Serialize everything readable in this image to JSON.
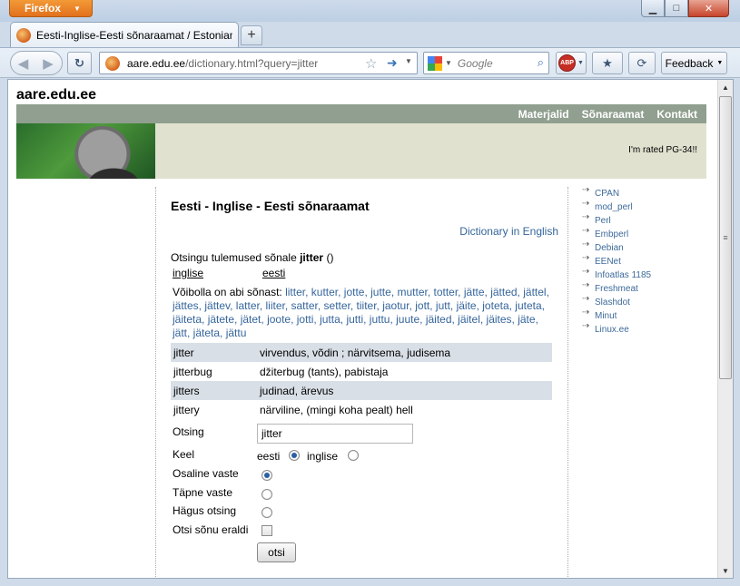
{
  "browser": {
    "menu_button": "Firefox",
    "tab_title": "Eesti-Inglise-Eesti sõnaraamat / Estonian...",
    "url_host": "aare.edu.ee",
    "url_path": "/dictionary.html?query=jitter",
    "search_placeholder": "Google",
    "abp_label": "ABP",
    "feedback_label": "Feedback"
  },
  "site": {
    "title": "aare.edu.ee",
    "nav": [
      "Materjalid",
      "Sõnaraamat",
      "Kontakt"
    ],
    "banner_text": "I'm rated PG-34!!"
  },
  "sidebar_links": [
    "CPAN",
    "mod_perl",
    "Perl",
    "Embperl",
    "Debian",
    "EENet",
    "Infoatlas 1185",
    "Freshmeat",
    "Slashdot",
    "Minut",
    "Linux.ee"
  ],
  "main": {
    "heading": "Eesti - Inglise - Eesti sõnaraamat",
    "english_link": "Dictionary in English",
    "results_prefix": "Otsingu tulemused sõnale",
    "query_word": "jitter",
    "results_suffix": "()",
    "col_left": "inglise",
    "col_right": "eesti",
    "suggest_prefix": "Võibolla on abi sõnast:",
    "suggest_words": "litter, kutter, jotte, jutte, mutter, totter, jätte, jätted, jättel, jättes, jättev, latter, liiter, satter, setter, tiiter, jaotur, jott, jutt, jäite, joteta, juteta, jäiteta, jätete, jätet, joote, jotti, jutta, jutti, juttu, juute, jäited, jäitel, jäites, jäte, jätt, jäteta, jättu",
    "results": [
      {
        "word": "jitter",
        "translation": "virvendus, võdin ; närvitsema, judisema"
      },
      {
        "word": "jitterbug",
        "translation": "džiterbug (tants), pabistaja"
      },
      {
        "word": "jitters",
        "translation": "judinad, ärevus"
      },
      {
        "word": "jittery",
        "translation": "närviline, (mingi koha pealt) hell"
      }
    ]
  },
  "form": {
    "search_label": "Otsing",
    "search_value": "jitter",
    "lang_label": "Keel",
    "lang_est": "eesti",
    "lang_eng": "inglise",
    "partial_label": "Osaline vaste",
    "exact_label": "Täpne vaste",
    "fuzzy_label": "Hägus otsing",
    "separate_label": "Otsi sõnu eraldi",
    "submit_label": "otsi"
  }
}
